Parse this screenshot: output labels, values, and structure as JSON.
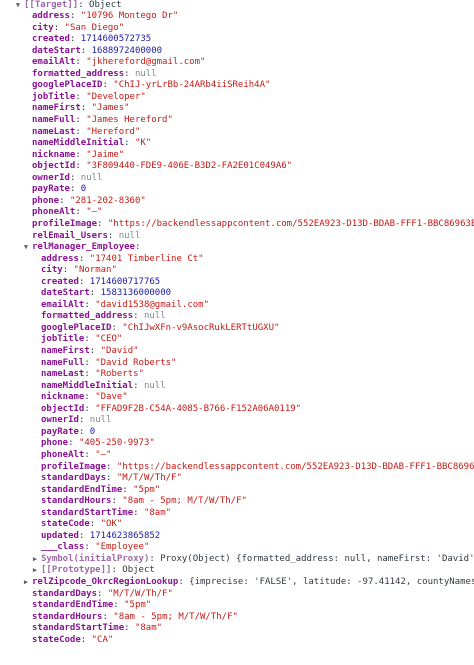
{
  "theme": {
    "key": "#881391",
    "string": "#c41a16",
    "number": "#1a1aa6",
    "null": "#80868b",
    "plain": "#303942"
  },
  "rows": [
    {
      "d": 0,
      "tri": "down",
      "key": "[[Target]]",
      "sep": ": ",
      "val": "Object",
      "t": "plain",
      "dim": true
    },
    {
      "d": 1,
      "key": "address",
      "sep": ": ",
      "val": "\"10796 Montego Dr\"",
      "t": "str"
    },
    {
      "d": 1,
      "key": "city",
      "sep": ": ",
      "val": "\"San Diego\"",
      "t": "str"
    },
    {
      "d": 1,
      "key": "created",
      "sep": ": ",
      "val": "1714600572735",
      "t": "num"
    },
    {
      "d": 1,
      "key": "dateStart",
      "sep": ": ",
      "val": "1688972400000",
      "t": "num"
    },
    {
      "d": 1,
      "key": "emailAlt",
      "sep": ": ",
      "val": "\"jkhereford@gmail.com\"",
      "t": "str"
    },
    {
      "d": 1,
      "key": "formatted_address",
      "sep": ": ",
      "val": "null",
      "t": "null"
    },
    {
      "d": 1,
      "key": "googlePlaceID",
      "sep": ": ",
      "val": "\"ChIJ-yrLrBb-24ARb4iiSReih4A\"",
      "t": "str"
    },
    {
      "d": 1,
      "key": "jobTitle",
      "sep": ": ",
      "val": "\"Developer\"",
      "t": "str"
    },
    {
      "d": 1,
      "key": "nameFirst",
      "sep": ": ",
      "val": "\"James\"",
      "t": "str"
    },
    {
      "d": 1,
      "key": "nameFull",
      "sep": ": ",
      "val": "\"James Hereford\"",
      "t": "str"
    },
    {
      "d": 1,
      "key": "nameLast",
      "sep": ": ",
      "val": "\"Hereford\"",
      "t": "str"
    },
    {
      "d": 1,
      "key": "nameMiddleInitial",
      "sep": ": ",
      "val": "\"K\"",
      "t": "str"
    },
    {
      "d": 1,
      "key": "nickname",
      "sep": ": ",
      "val": "\"Jaime\"",
      "t": "str"
    },
    {
      "d": 1,
      "key": "objectId",
      "sep": ": ",
      "val": "\"3F809440-FDE9-406E-B3D2-FA2E01C049A6\"",
      "t": "str"
    },
    {
      "d": 1,
      "key": "ownerId",
      "sep": ": ",
      "val": "null",
      "t": "null"
    },
    {
      "d": 1,
      "key": "payRate",
      "sep": ": ",
      "val": "0",
      "t": "num"
    },
    {
      "d": 1,
      "key": "phone",
      "sep": ": ",
      "val": "\"281-202-8360\"",
      "t": "str"
    },
    {
      "d": 1,
      "key": "phoneAlt",
      "sep": ": ",
      "val": "\"—\"",
      "t": "str"
    },
    {
      "d": 1,
      "key": "profileImage",
      "sep": ": ",
      "val": "\"https://backendlessappcontent.com/552EA923-D13D-BDAB-FFF1-BBC86963EF00/A70",
      "t": "str"
    },
    {
      "d": 1,
      "key": "relEmail_Users",
      "sep": ": ",
      "val": "null",
      "t": "null"
    },
    {
      "d": 1,
      "tri": "down",
      "key": "relManager_Employee",
      "sep": ":",
      "val": "",
      "t": "plain"
    },
    {
      "d": 2,
      "key": "address",
      "sep": ": ",
      "val": "\"17401 Timberline Ct\"",
      "t": "str"
    },
    {
      "d": 2,
      "key": "city",
      "sep": ": ",
      "val": "\"Norman\"",
      "t": "str"
    },
    {
      "d": 2,
      "key": "created",
      "sep": ": ",
      "val": "1714600717765",
      "t": "num"
    },
    {
      "d": 2,
      "key": "dateStart",
      "sep": ": ",
      "val": "1583136000000",
      "t": "num"
    },
    {
      "d": 2,
      "key": "emailAlt",
      "sep": ": ",
      "val": "\"david1538@gmail.com\"",
      "t": "str"
    },
    {
      "d": 2,
      "key": "formatted_address",
      "sep": ": ",
      "val": "null",
      "t": "null"
    },
    {
      "d": 2,
      "key": "googlePlaceID",
      "sep": ": ",
      "val": "\"ChIJwXFn-v9AsocRukLERTtUGXU\"",
      "t": "str"
    },
    {
      "d": 2,
      "key": "jobTitle",
      "sep": ": ",
      "val": "\"CEO\"",
      "t": "str"
    },
    {
      "d": 2,
      "key": "nameFirst",
      "sep": ": ",
      "val": "\"David\"",
      "t": "str"
    },
    {
      "d": 2,
      "key": "nameFull",
      "sep": ": ",
      "val": "\"David Roberts\"",
      "t": "str"
    },
    {
      "d": 2,
      "key": "nameLast",
      "sep": ": ",
      "val": "\"Roberts\"",
      "t": "str"
    },
    {
      "d": 2,
      "key": "nameMiddleInitial",
      "sep": ": ",
      "val": "null",
      "t": "null"
    },
    {
      "d": 2,
      "key": "nickname",
      "sep": ": ",
      "val": "\"Dave\"",
      "t": "str"
    },
    {
      "d": 2,
      "key": "objectId",
      "sep": ": ",
      "val": "\"FFAD9F2B-C54A-4085-B766-F152A06A0119\"",
      "t": "str"
    },
    {
      "d": 2,
      "key": "ownerId",
      "sep": ": ",
      "val": "null",
      "t": "null"
    },
    {
      "d": 2,
      "key": "payRate",
      "sep": ": ",
      "val": "0",
      "t": "num"
    },
    {
      "d": 2,
      "key": "phone",
      "sep": ": ",
      "val": "\"405-250-9973\"",
      "t": "str"
    },
    {
      "d": 2,
      "key": "phoneAlt",
      "sep": ": ",
      "val": "\"—\"",
      "t": "str"
    },
    {
      "d": 2,
      "key": "profileImage",
      "sep": ": ",
      "val": "\"https://backendlessappcontent.com/552EA923-D13D-BDAB-FFF1-BBC86963EF00/A70",
      "t": "str"
    },
    {
      "d": 2,
      "key": "standardDays",
      "sep": ": ",
      "val": "\"M/T/W/Th/F\"",
      "t": "str"
    },
    {
      "d": 2,
      "key": "standardEndTime",
      "sep": ": ",
      "val": "\"5pm\"",
      "t": "str"
    },
    {
      "d": 2,
      "key": "standardHours",
      "sep": ": ",
      "val": "\"8am - 5pm;   M/T/W/Th/F\"",
      "t": "str"
    },
    {
      "d": 2,
      "key": "standardStartTime",
      "sep": ": ",
      "val": "\"8am\"",
      "t": "str"
    },
    {
      "d": 2,
      "key": "stateCode",
      "sep": ": ",
      "val": "\"OK\"",
      "t": "str"
    },
    {
      "d": 2,
      "key": "updated",
      "sep": ": ",
      "val": "1714623865852",
      "t": "num"
    },
    {
      "d": 2,
      "key": "___class",
      "sep": ": ",
      "val": "\"Employee\"",
      "t": "str"
    },
    {
      "d": 2,
      "tri": "right",
      "key": "Symbol(initialProxy)",
      "sep": ": ",
      "val": "Proxy(Object) {formatted_address: null, nameFirst: 'David', standar",
      "t": "plain",
      "dim": true
    },
    {
      "d": 2,
      "tri": "right",
      "key": "[[Prototype]]",
      "sep": ": ",
      "val": "Object",
      "t": "plain",
      "dim": true
    },
    {
      "d": 1,
      "tri": "right",
      "key": "relZipcode_OkrcRegionLookup",
      "sep": ": ",
      "val": "{imprecise: 'FALSE', latitude: -97.41142, countyNames: 'Clev",
      "t": "plain"
    },
    {
      "d": 1,
      "key": "standardDays",
      "sep": ": ",
      "val": "\"M/T/W/Th/F\"",
      "t": "str"
    },
    {
      "d": 1,
      "key": "standardEndTime",
      "sep": ": ",
      "val": "\"5pm\"",
      "t": "str"
    },
    {
      "d": 1,
      "key": "standardHours",
      "sep": ": ",
      "val": "\"8am - 5pm;   M/T/W/Th/F\"",
      "t": "str"
    },
    {
      "d": 1,
      "key": "standardStartTime",
      "sep": ": ",
      "val": "\"8am\"",
      "t": "str"
    },
    {
      "d": 1,
      "key": "stateCode",
      "sep": ": ",
      "val": "\"CA\"",
      "t": "str"
    }
  ]
}
